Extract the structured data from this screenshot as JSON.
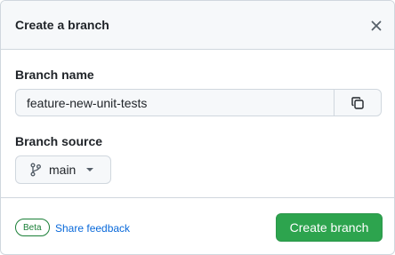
{
  "dialog": {
    "title": "Create a branch",
    "close_icon": "close-icon"
  },
  "branch_name": {
    "label": "Branch name",
    "value": "feature-new-unit-tests",
    "copy_icon": "copy-icon"
  },
  "branch_source": {
    "label": "Branch source",
    "selected": "main",
    "icon": "git-branch-icon",
    "dropdown_icon": "caret-down-icon"
  },
  "footer": {
    "badge": "Beta",
    "feedback_link": "Share feedback",
    "submit_label": "Create branch"
  },
  "colors": {
    "accent_green": "#2da44e",
    "link_blue": "#0969da",
    "border": "#d0d7de"
  }
}
